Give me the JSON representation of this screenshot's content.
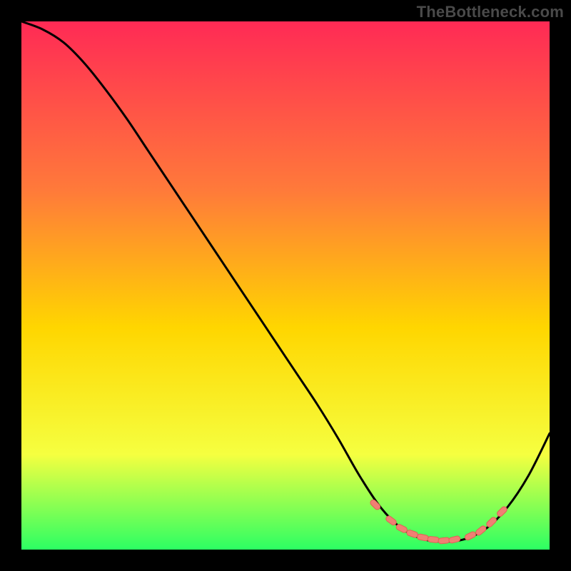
{
  "watermark": "TheBottleneck.com",
  "colors": {
    "gradient_top": "#ff2a55",
    "gradient_upper_mid": "#ff7a3a",
    "gradient_mid": "#ffd600",
    "gradient_lower_mid": "#f5ff40",
    "gradient_bottom": "#2cff63",
    "frame": "#000000",
    "curve": "#000000",
    "marker_fill": "#f08073",
    "marker_stroke": "#e06055"
  },
  "chart_data": {
    "type": "line",
    "title": "",
    "xlabel": "",
    "ylabel": "",
    "xlim": [
      0,
      100
    ],
    "ylim": [
      0,
      100
    ],
    "series": [
      {
        "name": "bottleneck-curve",
        "x": [
          0,
          4,
          8,
          12,
          16,
          20,
          24,
          28,
          32,
          36,
          40,
          44,
          48,
          52,
          56,
          60,
          64,
          68,
          72,
          76,
          80,
          84,
          88,
          92,
          96,
          100
        ],
        "values": [
          100,
          98.5,
          96,
          92,
          87,
          81.5,
          75.5,
          69.5,
          63.5,
          57.5,
          51.5,
          45.5,
          39.5,
          33.5,
          27.5,
          21,
          14,
          8,
          4,
          2,
          1.5,
          2,
          4,
          8,
          14,
          22
        ]
      }
    ],
    "markers": {
      "name": "highlight-range",
      "x": [
        67,
        70,
        72,
        74,
        76,
        78,
        80,
        82,
        85,
        87,
        89,
        91
      ],
      "values": [
        8.5,
        5.5,
        4,
        3,
        2.3,
        1.9,
        1.7,
        1.9,
        2.6,
        3.6,
        5.2,
        7.2
      ]
    }
  }
}
